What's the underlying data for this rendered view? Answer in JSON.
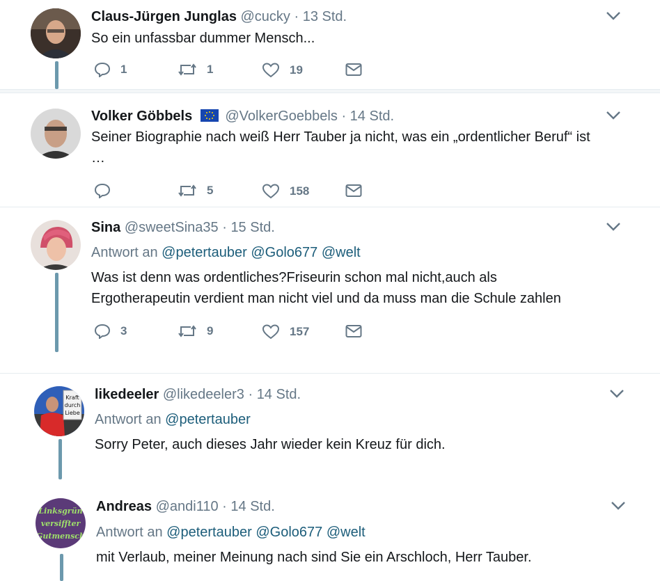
{
  "icons": {
    "reply": "reply-icon",
    "retweet": "retweet-icon",
    "like": "heart-icon",
    "dm": "envelope-icon",
    "caret": "chevron-down-icon",
    "flag": "eu-flag-icon"
  },
  "colors": {
    "thread_line": "#6c99ad",
    "mention": "#1c5d7a",
    "muted": "#657786"
  },
  "tweets": [
    {
      "name": "Claus-Jürgen Junglas",
      "handle": "@cucky",
      "dot": "·",
      "time": "13 Std.",
      "text": "So ein unfassbar dummer Mensch...",
      "replies": "1",
      "retweets": "1",
      "likes": "19"
    },
    {
      "name": "Volker Göbbels",
      "handle": "@VolkerGoebbels",
      "dot": "·",
      "time": "14 Std.",
      "text_line1": "Seiner Biographie nach weiß Herr Tauber ja nicht, was ein „ordentlicher Beruf“ ist",
      "text_line2": "…",
      "replies": "",
      "retweets": "5",
      "likes": "158"
    },
    {
      "name": "Sina",
      "handle": "@sweetSina35",
      "dot": "·",
      "time": "15 Std.",
      "reply_prefix": "Antwort an",
      "mentions": [
        "@petertauber",
        "@Golo677",
        "@welt"
      ],
      "text_line1": "Was ist denn was ordentliches?Friseurin schon mal nicht,auch als",
      "text_line2": "Ergotherapeutin verdient man nicht viel und da muss man die Schule zahlen",
      "replies": "3",
      "retweets": "9",
      "likes": "157"
    },
    {
      "name": "likedeeler",
      "handle": "@likedeeler3",
      "dot": "·",
      "time": "14 Std.",
      "reply_prefix": "Antwort an",
      "mentions": [
        "@petertauber"
      ],
      "text": "Sorry Peter, auch dieses Jahr wieder kein Kreuz für dich.",
      "avatar_sign": [
        "Kraft",
        "durch",
        "Liebe"
      ]
    },
    {
      "name": "Andreas",
      "handle": "@andi110",
      "dot": "·",
      "time": "14 Std.",
      "reply_prefix": "Antwort an",
      "mentions": [
        "@petertauber",
        "@Golo677",
        "@welt"
      ],
      "text": "mit Verlaub, meiner Meinung nach sind Sie ein Arschloch, Herr Tauber.",
      "avatar_text": [
        "Linksgrün",
        "versiffter",
        "Gutmensch"
      ]
    }
  ]
}
